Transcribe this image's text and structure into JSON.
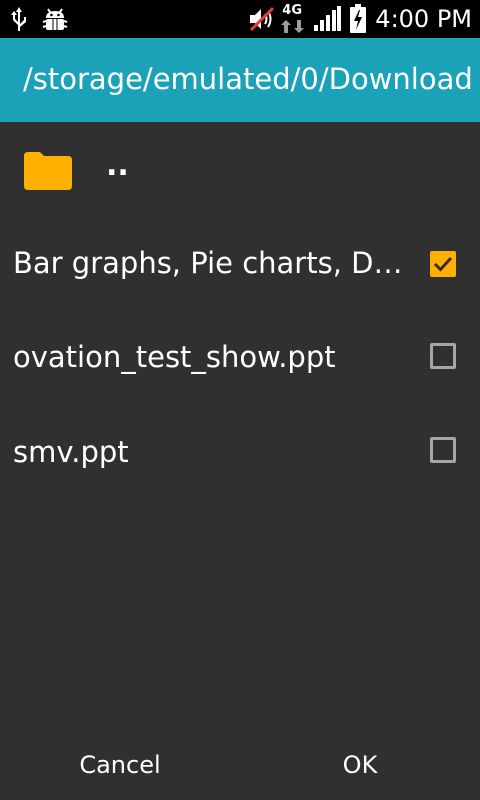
{
  "status_bar": {
    "time": "4:00 PM",
    "network_label": "4G",
    "icons": [
      "usb-icon",
      "android-debug-icon",
      "volume-muted-icon",
      "network-4g-icon",
      "signal-icon",
      "battery-charging-icon"
    ]
  },
  "title_bar": {
    "path": "/storage/emulated/0/Download",
    "color": "#1ba1b8"
  },
  "file_list": {
    "parent_entry": {
      "label": "..",
      "icon": "folder-icon",
      "icon_color": "#ffb000"
    },
    "items": [
      {
        "label": "Bar graphs, Pie charts, D…",
        "checked": true
      },
      {
        "label": "ovation_test_show.ppt",
        "checked": false
      },
      {
        "label": "smv.ppt",
        "checked": false
      }
    ]
  },
  "buttons": {
    "cancel_label": "Cancel",
    "ok_label": "OK"
  },
  "colors": {
    "background": "#303030",
    "accent": "#ffb000",
    "checkbox_border": "#a6a6a6"
  }
}
